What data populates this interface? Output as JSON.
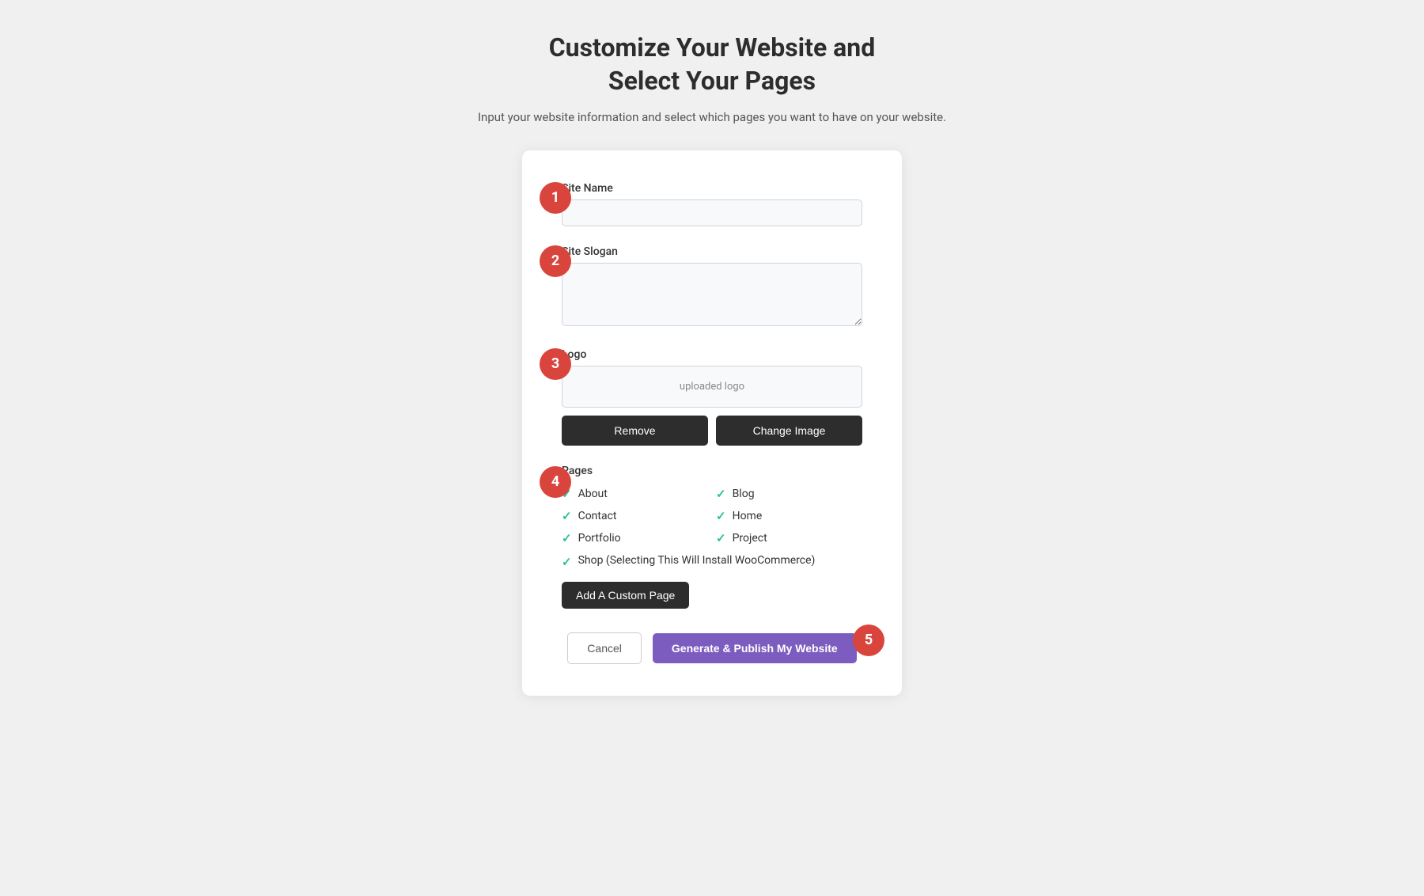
{
  "header": {
    "title_line1": "Customize Your Website and",
    "title_line2": "Select Your Pages",
    "subtitle": "Input your website information and select which pages you want to have on your website."
  },
  "form": {
    "site_name_label": "Site Name",
    "site_name_placeholder": "",
    "site_slogan_label": "Site Slogan",
    "site_slogan_placeholder": "",
    "logo_label": "Logo",
    "logo_preview_text": "uploaded logo",
    "remove_button": "Remove",
    "change_image_button": "Change Image",
    "pages_label": "Pages",
    "pages": [
      {
        "name": "About",
        "checked": true,
        "col": 1
      },
      {
        "name": "Blog",
        "checked": true,
        "col": 2
      },
      {
        "name": "Contact",
        "checked": true,
        "col": 1
      },
      {
        "name": "Home",
        "checked": true,
        "col": 2
      },
      {
        "name": "Portfolio",
        "checked": true,
        "col": 1
      },
      {
        "name": "Project",
        "checked": true,
        "col": 2
      }
    ],
    "shop_page": {
      "name": "Shop (Selecting This Will Install WooCommerce)",
      "checked": true
    },
    "add_custom_page_button": "Add A Custom Page",
    "cancel_button": "Cancel",
    "generate_button": "Generate & Publish My Website"
  },
  "steps": {
    "badge_1": "1",
    "badge_2": "2",
    "badge_3": "3",
    "badge_4": "4",
    "badge_5": "5"
  },
  "colors": {
    "accent_red": "#d9453d",
    "accent_purple": "#7c5cbf",
    "accent_teal": "#2bbf9c",
    "button_dark": "#2d2d2d"
  }
}
